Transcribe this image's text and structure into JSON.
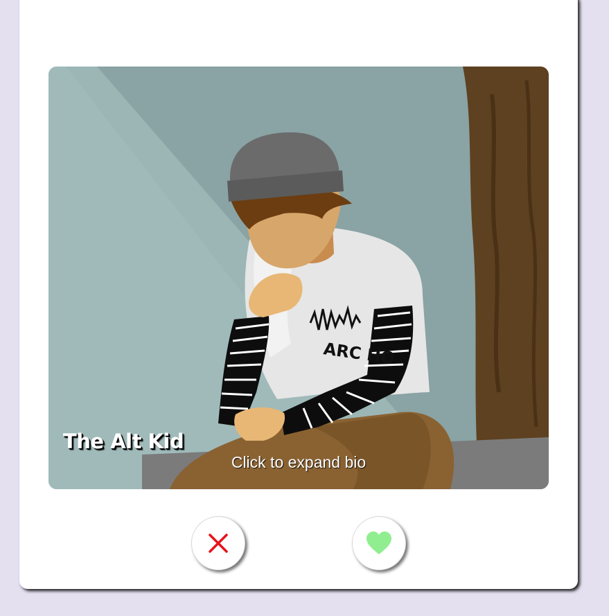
{
  "profile": {
    "name": "The Alt Kid",
    "expand_hint": "Click to expand bio",
    "shirt_text": "ARC HO"
  },
  "actions": {
    "dislike_icon": "close-icon",
    "like_icon": "heart-icon",
    "dislike_color": "#e8111b",
    "like_color": "#90ee90"
  },
  "colors": {
    "page_background": "#e4e0f0",
    "card_background": "#ffffff"
  }
}
